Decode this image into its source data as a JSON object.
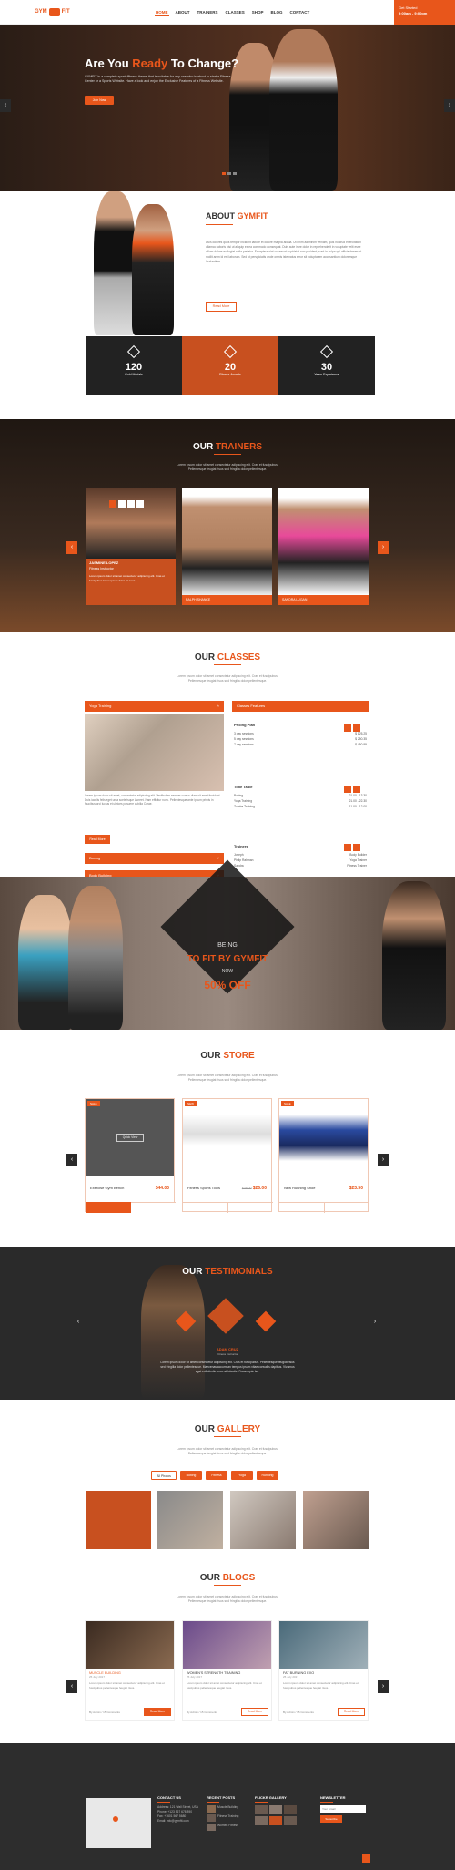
{
  "brand": {
    "name_left": "GYM",
    "name_right": "FIT",
    "accent": "#e8561b"
  },
  "nav": {
    "items": [
      "HOME",
      "ABOUT",
      "TRAINERS",
      "CLASSES",
      "SHOP",
      "BLOG",
      "CONTACT"
    ],
    "active": "HOME"
  },
  "header_cta": {
    "line1": "Get Started",
    "line2": "9:00am - 9:00pm"
  },
  "hero": {
    "title_pre": "Are You ",
    "title_accent": "Ready",
    "title_post": " To Change?",
    "text": "GYMFIT is a complete sports/fitness theme that is suitable for any one who is about to start a Fitness Center or a Sports Website. Have a look and enjoy the Exclusive Features of a Fitness Website.",
    "button": "Join Now"
  },
  "about": {
    "title_pre": "ABOUT ",
    "title_accent": "GYMFIT",
    "text": "Duis dolores quos tempor incidunt labore et dolore magna aliqua. Ut enim ad minim veniam, quis nostrud exercitation ullamco laboris nisi ut aliquip ex ea commodo consequat. Duis aute irure dolor in reprehenderit in voluptate velit esse cillum dolore eu fugiat nulla pariatur. Excepteur sint occaecat cupidatat non proident, sunt in culpa qui officia deserunt mollit anim id est laborum. Sed ut perspiciatis unde omnis iste natus error sit voluptatem accusantium doloremque laudantium.",
    "button": "Read More",
    "stats": [
      {
        "num": "120",
        "label": "Gold Medals"
      },
      {
        "num": "20",
        "label": "Fitness Awards"
      },
      {
        "num": "30",
        "label": "Years Experience"
      }
    ]
  },
  "trainers": {
    "title_pre": "OUR ",
    "title_accent": "TRAINERS",
    "sub": "Lorem ipsum dolor sit amet consectetur adipiscing elit. Cras et fuscipubus. Pellentesque feugiat risus sed fringilla dolor pellentesque.",
    "cards": [
      {
        "name": "JASMINE LOPEZ",
        "role": "Fitness Instructor",
        "text": "Lorem ipsum dolor sit amet consectetur adipiscing elit. Cras et fuscipubus lorem ipsum dolor sit amet."
      },
      {
        "name": "RALPH SHANCE",
        "role": ""
      },
      {
        "name": "SANDRA LUGAN",
        "role": ""
      }
    ]
  },
  "classes": {
    "title_pre": "OUR ",
    "title_accent": "CLASSES",
    "sub": "Lorem ipsum dolor sit amet consectetur adipiscing elit. Cras et fuscipubus. Pellentesque feugiat risus sed fringilla dolor pellentesque.",
    "acc_open": "Yoga Training",
    "acc_text": "Lorem ipsum dolor sit amet, consectetur adipiscing elit. Vestibulum semper cursus diam sit amet tincidunt. Duis iaculis felis eget urna scelerisque laoreet. Nam efficitur nunc. Pellentesque ante ipsum primis in faucibus orci luctus et ultrices posuere cubilia Curae.",
    "acc_button": "Read More",
    "acc_closed": [
      "Boxing",
      "Body Building"
    ],
    "features_title": "Classes Features",
    "pricing_title": "Pricing Plan",
    "pricing": [
      [
        "3 day sessions",
        "$ 125.25"
      ],
      [
        "5 day sessions",
        "$ 250.35"
      ],
      [
        "7 day sessions",
        "$ 450.99"
      ]
    ],
    "timetable_title": "Time Table",
    "timetable": [
      [
        "Boxing",
        "21.00 - 13.30"
      ],
      [
        "Yoga Training",
        "21.00 - 22.30"
      ],
      [
        "Zumba Training",
        "11.00 - 12.00"
      ]
    ],
    "trainers_title": "Trainers",
    "trainers": [
      [
        "Joseph",
        "Body Builder"
      ],
      [
        "Philip Rahman",
        "Yoga Trainer"
      ],
      [
        "Sandra",
        "Fitness Trainer"
      ]
    ]
  },
  "promo": {
    "line1": "BEING",
    "line2": "TO FIT BY GYMFIT",
    "line3": "NOW",
    "line4": "50% OFF"
  },
  "store": {
    "title_pre": "OUR ",
    "title_accent": "STORE",
    "sub": "Lorem ipsum dolor sit amet consectetur adipiscing elit. Cras et fuscipubus. Pellentesque feugiat risus sed fringilla dolor pellentesque.",
    "products": [
      {
        "badge": "SALE",
        "name": "Exercise Gym Bench",
        "old": "",
        "price": "$44.00",
        "overlay": "Quick View"
      },
      {
        "badge": "NEW",
        "name": "Fitness Sports Tools",
        "old": "$38.00",
        "price": "$26.00"
      },
      {
        "badge": "SALE",
        "name": "New Running Shoe",
        "old": "",
        "price": "$23.50"
      }
    ]
  },
  "testimonials": {
    "title_pre": "OUR ",
    "title_accent": "TESTIMONIALS",
    "name": "ADAM CRUZ",
    "role": "Fitness Instructor",
    "text": "Lorem ipsum dolor sit amet consectetur adipiscing elit. Cras et fuscipubus. Pellentesque feugiat risus sed fringilla dolor pellentesque. Maecenas accumsan tempus ipsum vitae convallis dapibus. Vivamus eget sollicitudin nunc et lobortis. Donec quis leo."
  },
  "gallery": {
    "title_pre": "OUR ",
    "title_accent": "GALLERY",
    "sub": "Lorem ipsum dolor sit amet consectetur adipiscing elit. Cras et fuscipubus. Pellentesque feugiat risus sed fringilla dolor pellentesque.",
    "tabs": [
      "All Photos",
      "Boxing",
      "Fitness",
      "Yoga",
      "Running"
    ]
  },
  "blogs": {
    "title_pre": "OUR ",
    "title_accent": "BLOGS",
    "sub": "Lorem ipsum dolor sit amet consectetur adipiscing elit. Cras et fuscipubus. Pellentesque feugiat risus sed fringilla dolor pellentesque.",
    "posts": [
      {
        "title": "MUSCLE BUILDING",
        "date": "25 July 2017",
        "meta": "By Admin / 15 Comments",
        "button": "Read More"
      },
      {
        "title": "WOMEN'S STRENGTH TRAINING",
        "date": "25 July 2017",
        "meta": "By Admin / 15 Comments",
        "button": "Read More"
      },
      {
        "title": "FAT BURNING EXO",
        "date": "25 July 2017",
        "meta": "By Admin / 15 Comments",
        "button": "Read More"
      }
    ],
    "text": "Lorem ipsum dolor sit amet consectetur adipiscing elit. Cras et fuscipubus pellentesque feugiat risus."
  },
  "footer": {
    "contact_title": "CONTACT US",
    "contact_lines": [
      "Address: 121 Wall Street, USA",
      "Phone: +123 567 678 890",
      "Fax: +1601 567 5680",
      "Email: info@gymfit.com"
    ],
    "posts_title": "RECENT POSTS",
    "posts": [
      "Muscle Building",
      "Fitness Training",
      "Women Fitness"
    ],
    "flickr_title": "FLICKR GALLERY",
    "news_title": "NEWSLETTER",
    "news_placeholder": "Your Email",
    "news_button": "Subscribe"
  }
}
